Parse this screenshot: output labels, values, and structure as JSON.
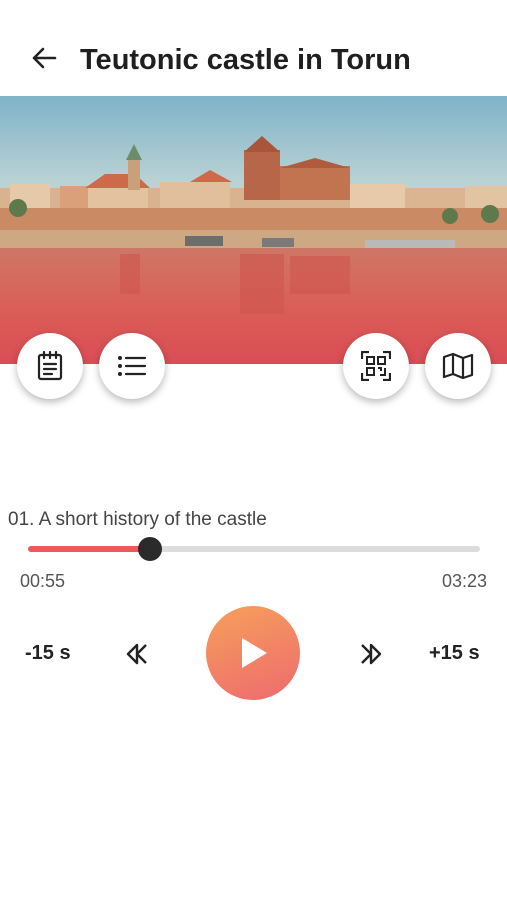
{
  "header": {
    "title": "Teutonic castle in Torun",
    "back_icon": "arrow-left-icon"
  },
  "hero": {
    "image_subject": "Teutonic castle in Torun",
    "overlay_color": "#e0555a"
  },
  "actions": {
    "left": [
      {
        "icon": "notepad-icon"
      },
      {
        "icon": "list-icon"
      }
    ],
    "right": [
      {
        "icon": "qr-scan-icon"
      },
      {
        "icon": "map-icon"
      }
    ]
  },
  "player": {
    "track_title": "01. A short history of the castle",
    "elapsed": "00:55",
    "total": "03:23",
    "progress_fraction": 0.271,
    "rewind_label": "-15 s",
    "forward_label": "+15 s",
    "accent_color": "#ee5a5a"
  }
}
